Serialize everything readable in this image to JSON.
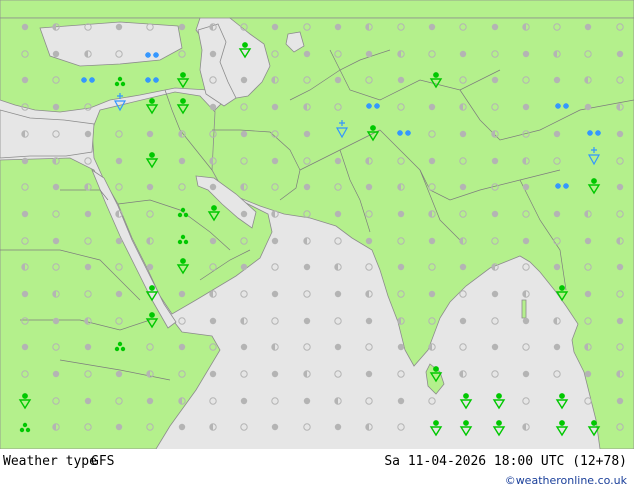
{
  "footer": {
    "product": "Weather type",
    "model": "GFS",
    "valid_time": "Sa 11-04-2026 18:00 UTC (12+78)",
    "credit": "©weatheronline.co.uk"
  },
  "colors": {
    "land": "#b4f08c",
    "sea": "#e6e6e6",
    "border": "#7d7d7d",
    "coast": "#8c8c8c",
    "dot": "#b4b4b4",
    "rain_symbol": "#00c800",
    "snow_symbol": "#3296ff"
  },
  "map": {
    "legend_icons": [
      "filled-dot",
      "half-dot",
      "open-dot",
      "shower",
      "rain-shower",
      "snow",
      "snow-shower"
    ],
    "region": "Middle East and South Asia"
  }
}
